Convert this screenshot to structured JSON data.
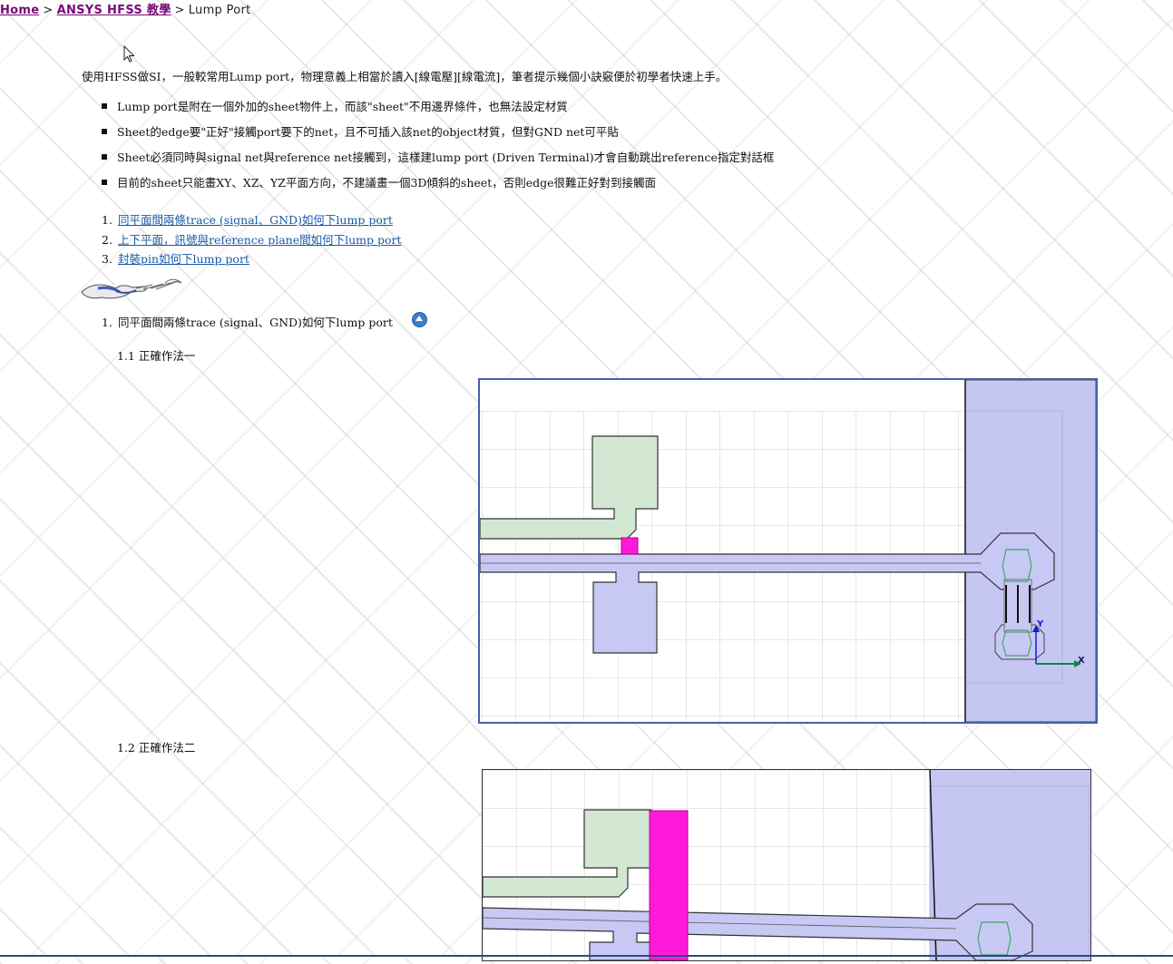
{
  "breadcrumb": {
    "home": "Home",
    "separator": ">",
    "category": "ANSYS HFSS 教學",
    "current": "Lump Port"
  },
  "intro": "使用HFSS做SI，一般較常用Lump port，物理意義上相當於讀入[線電壓][線電流]，筆者提示幾個小訣竅便於初學者快速上手。",
  "bullets": [
    "Lump port是附在一個外加的sheet物件上，而該\"sheet\"不用邊界條件，也無法設定材質",
    "Sheet的edge要\"正好\"接觸port要下的net，且不可插入該net的object材質，但對GND net可平貼",
    "Sheet必須同時與signal net與reference net接觸到，這樣建lump port (Driven Terminal)才會自動跳出reference指定對話框",
    "目前的sheet只能畫XY、XZ、YZ平面方向，不建議畫一個3D傾斜的sheet，否則edge很難正好對到接觸面"
  ],
  "toc": [
    {
      "num": "1.",
      "label": "同平面間兩條trace (signal、GND)如何下lump port"
    },
    {
      "num": "2.",
      "label": "上下平面，訊號與reference plane間如何下lump port"
    },
    {
      "num": "3.",
      "label": "封裝pin如何下lump port"
    }
  ],
  "section1": {
    "num": "1.",
    "title": "同平面間兩條trace (signal、GND)如何下lump port",
    "sub1": "1.1 正確作法一",
    "sub2": "1.2 正確作法二"
  },
  "figure1": {
    "axis_y": "Y",
    "axis_x": "X"
  },
  "colors": {
    "link": "#1a5aa8",
    "visited": "#7a0a78",
    "signal_trace": "#c8c8f5",
    "gnd_trace": "#d3e8d3",
    "port_sheet": "#ff1ad9",
    "substrate": "#c6c6f3"
  },
  "icons": [
    "mouse-cursor-icon",
    "pointing-hand-icon",
    "back-to-top-icon"
  ]
}
